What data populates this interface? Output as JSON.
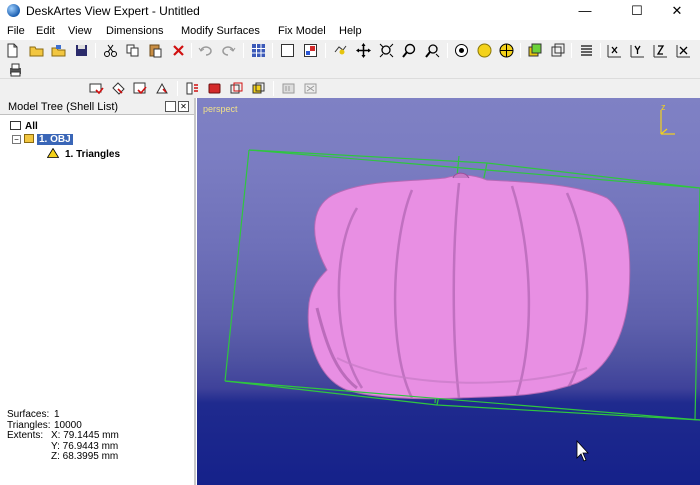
{
  "window": {
    "title": "DeskArtes View Expert - Untitled",
    "minimize_glyph": "—",
    "maximize_glyph": "☐",
    "close_glyph": "✕"
  },
  "menu": {
    "file": "File",
    "edit": "Edit",
    "view": "View",
    "dimensions": "Dimensions",
    "modify_surfaces": "Modify Surfaces",
    "fix_model": "Fix Model",
    "help": "Help"
  },
  "model_tree": {
    "title": "Model Tree (Shell List)",
    "root_label": "All",
    "obj_label": "1. OBJ",
    "shell_label": "1. Triangles",
    "expand_glyph": "−"
  },
  "stats": {
    "surfaces_label": "Surfaces:",
    "surfaces_value": "1",
    "triangles_label": "Triangles:",
    "triangles_value": "10000",
    "extents_label": "Extents:",
    "x": "X: 79.1445 mm",
    "y": "Y: 76.9443 mm",
    "z": "Z: 68.3995 mm"
  },
  "viewport": {
    "label": "perspect",
    "axis_label": "z"
  },
  "colors": {
    "model_fill": "#e88fe3",
    "bbox_stroke": "#2fc63f",
    "selection": "#3a66b7",
    "viewport_label": "#f0e08a"
  }
}
